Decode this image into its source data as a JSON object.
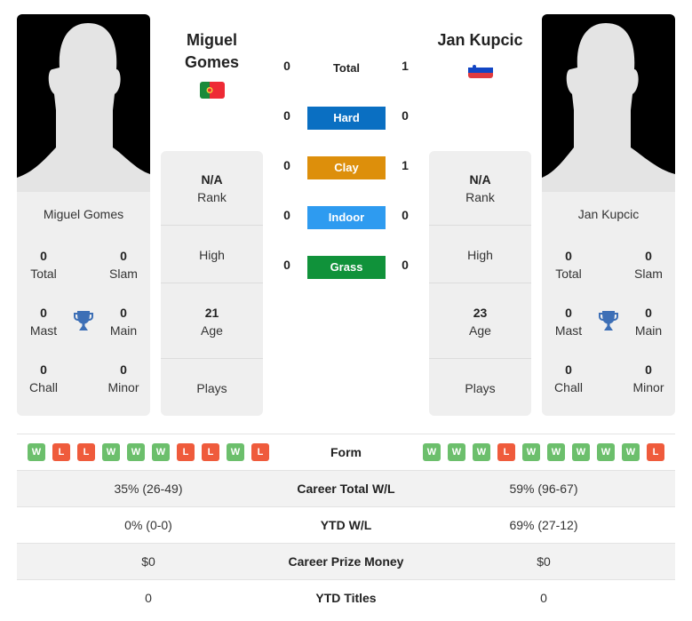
{
  "player1": {
    "name": "Miguel Gomes",
    "name_line1": "Miguel",
    "name_line2": "Gomes",
    "flag": "portugal-flag",
    "card_name": "Miguel Gomes",
    "titles": {
      "total": {
        "value": "0",
        "label": "Total"
      },
      "slam": {
        "value": "0",
        "label": "Slam"
      },
      "mast": {
        "value": "0",
        "label": "Mast"
      },
      "main": {
        "value": "0",
        "label": "Main"
      },
      "chall": {
        "value": "0",
        "label": "Chall"
      },
      "minor": {
        "value": "0",
        "label": "Minor"
      }
    },
    "info": {
      "rank_value": "N/A",
      "rank_label": "Rank",
      "high_label": "High",
      "age_value": "21",
      "age_label": "Age",
      "plays_label": "Plays"
    },
    "form": [
      "W",
      "L",
      "L",
      "W",
      "W",
      "W",
      "L",
      "L",
      "W",
      "L"
    ],
    "career_wl": "35% (26-49)",
    "ytd_wl": "0% (0-0)",
    "prize": "$0",
    "ytd_titles": "0"
  },
  "player2": {
    "name": "Jan Kupcic",
    "flag": "slovenia-flag",
    "card_name": "Jan Kupcic",
    "titles": {
      "total": {
        "value": "0",
        "label": "Total"
      },
      "slam": {
        "value": "0",
        "label": "Slam"
      },
      "mast": {
        "value": "0",
        "label": "Mast"
      },
      "main": {
        "value": "0",
        "label": "Main"
      },
      "chall": {
        "value": "0",
        "label": "Chall"
      },
      "minor": {
        "value": "0",
        "label": "Minor"
      }
    },
    "info": {
      "rank_value": "N/A",
      "rank_label": "Rank",
      "high_label": "High",
      "age_value": "23",
      "age_label": "Age",
      "plays_label": "Plays"
    },
    "form": [
      "W",
      "W",
      "W",
      "L",
      "W",
      "W",
      "W",
      "W",
      "W",
      "L"
    ],
    "career_wl": "59% (96-67)",
    "ytd_wl": "69% (27-12)",
    "prize": "$0",
    "ytd_titles": "0"
  },
  "h2h": [
    {
      "label": "Total",
      "p1": "0",
      "p2": "1",
      "color": null
    },
    {
      "label": "Hard",
      "p1": "0",
      "p2": "0",
      "color": "#0a6fc2"
    },
    {
      "label": "Clay",
      "p1": "0",
      "p2": "1",
      "color": "#dd8f0b"
    },
    {
      "label": "Indoor",
      "p1": "0",
      "p2": "0",
      "color": "#2e9bf0"
    },
    {
      "label": "Grass",
      "p1": "0",
      "p2": "0",
      "color": "#10923a"
    }
  ],
  "stats_labels": {
    "form": "Form",
    "career_wl": "Career Total W/L",
    "ytd_wl": "YTD W/L",
    "prize": "Career Prize Money",
    "ytd_titles": "YTD Titles"
  },
  "colors": {
    "win": "#6cbf6c",
    "loss": "#ef5b3c",
    "trophy": "#3d6fb6"
  }
}
